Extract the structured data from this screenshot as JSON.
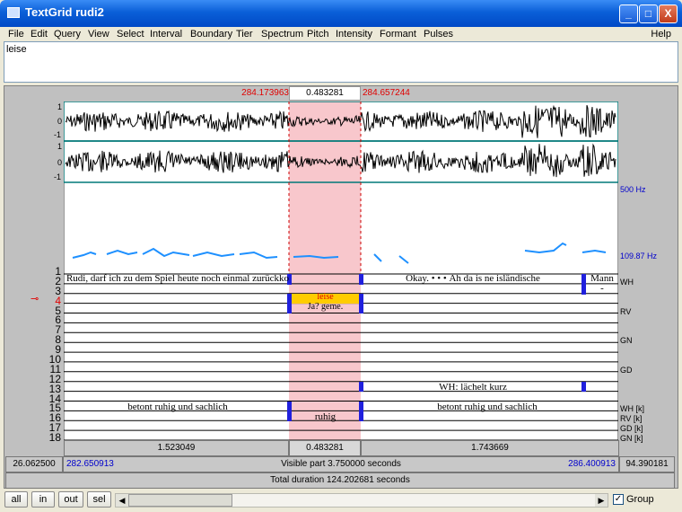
{
  "window": {
    "title": "TextGrid rudi2"
  },
  "title_buttons": {
    "min": "_",
    "max": "□",
    "close": "X"
  },
  "menu": [
    "File",
    "Edit",
    "Query",
    "View",
    "Select",
    "Interval",
    "Boundary",
    "Tier",
    "Spectrum",
    "Pitch",
    "Intensity",
    "Formant",
    "Pulses"
  ],
  "menu_help": "Help",
  "text_window": "leise",
  "selection": {
    "start": "284.173963",
    "duration": "0.483281",
    "end": "284.657244"
  },
  "waveform_axis": {
    "ch1_top": "1",
    "ch1_mid": "0",
    "ch1_bot": "-1",
    "ch2_top": "1",
    "ch2_mid": "0",
    "ch2_bot": "-1"
  },
  "pitch_axis": {
    "top": "500 Hz",
    "bottom": "109.87 Hz"
  },
  "tiers": [
    {
      "num": "1",
      "name": ""
    },
    {
      "num": "2",
      "name": "WH"
    },
    {
      "num": "3",
      "name": ""
    },
    {
      "num": "4",
      "name": ""
    },
    {
      "num": "5",
      "name": "RV"
    },
    {
      "num": "6",
      "name": ""
    },
    {
      "num": "7",
      "name": ""
    },
    {
      "num": "8",
      "name": "GN"
    },
    {
      "num": "9",
      "name": ""
    },
    {
      "num": "10",
      "name": ""
    },
    {
      "num": "11",
      "name": "GD"
    },
    {
      "num": "12",
      "name": ""
    },
    {
      "num": "13",
      "name": ""
    },
    {
      "num": "14",
      "name": ""
    },
    {
      "num": "15",
      "name": "WH [k]"
    },
    {
      "num": "16",
      "name": "RV [k]"
    },
    {
      "num": "17",
      "name": "GD [k]"
    },
    {
      "num": "18",
      "name": "GN [k]"
    }
  ],
  "intervals": {
    "t2_left": "Rudi, darf ich zu dem Spiel heute noch einmal zurückko",
    "t2_right": "Okay. • • • Äh da is ne isländische",
    "t2_far": "Mann",
    "t3_dash": "-",
    "t4_sel": "leise",
    "t5_sel": "Ja? geme.",
    "t13_right": "WH: lächelt kurz",
    "t15_left": "betont ruhig und sachlich",
    "t15_right": "betont ruhig und sachlich",
    "t16_sel": "ruhig"
  },
  "durations": {
    "left": "1.523049",
    "mid": "0.483281",
    "right": "1.743669"
  },
  "visible": {
    "abs_start": "26.062500",
    "start": "282.650913",
    "label": "Visible part 3.750000 seconds",
    "end": "286.400913",
    "abs_end": "94.390181"
  },
  "total": "Total duration 124.202681 seconds",
  "buttons": {
    "all": "all",
    "in": "in",
    "out": "out",
    "sel": "sel"
  },
  "group": {
    "label": "Group",
    "checked": "✓"
  },
  "colors": {
    "selection": "#f8c7cc",
    "teal_border": "#007878",
    "pitch": "#1e90ff",
    "boundary": "#2020dd",
    "highlight": "#ffcc00"
  }
}
